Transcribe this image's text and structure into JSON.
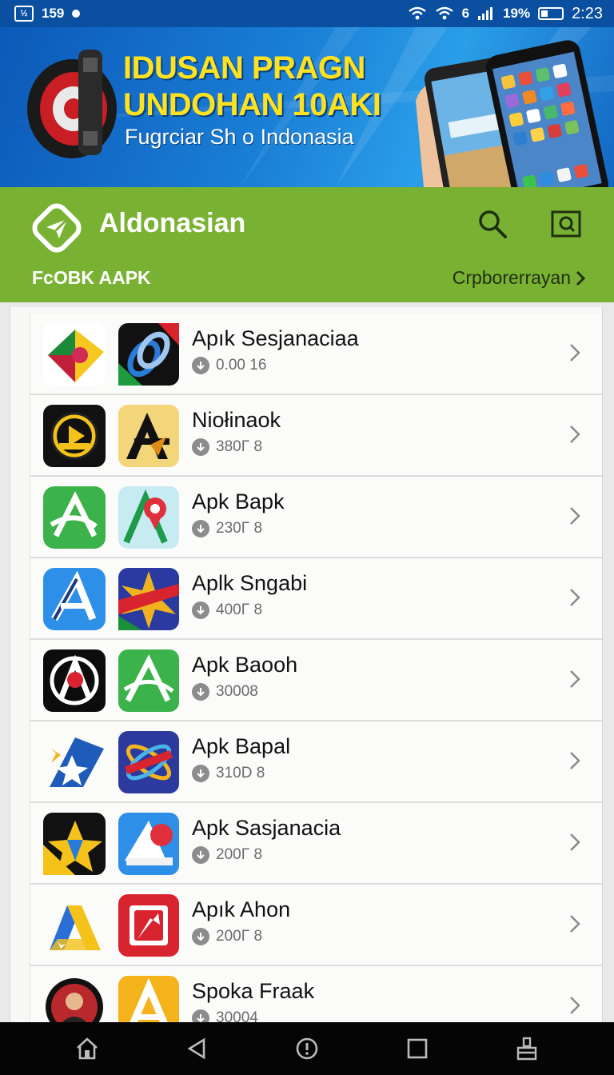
{
  "status_bar": {
    "notif_box": "½",
    "carrier": "159",
    "network": "6",
    "battery_percent": "19%",
    "time": "2:23"
  },
  "banner": {
    "title_line1": "IDUSAN PRAGN",
    "title_line2": "UNDOHAN 10AKI",
    "subtitle": "Fugrciar Sh o Indonasia"
  },
  "header": {
    "app_name": "Aldonasian",
    "section_label": "FcOBK AAPK",
    "right_link": "Crpborerrayan"
  },
  "apps": [
    {
      "name": "Apık Sesjanaciaa",
      "meta": "0.00 16",
      "icon1": "kite-app-icon",
      "icon2": "chain-link-app-icon"
    },
    {
      "name": "Niołinaok",
      "meta": "380Γ 8",
      "icon1": "play-badge-app-icon",
      "icon2": "letter-a-yellow-app-icon"
    },
    {
      "name": "Apk Bapk",
      "meta": "230Γ 8",
      "icon1": "green-a-app-icon",
      "icon2": "map-pin-a-app-icon"
    },
    {
      "name": "Aplk Sngabi",
      "meta": "400Γ 8",
      "icon1": "blue-a-app-icon",
      "icon2": "burst-sticker-app-icon"
    },
    {
      "name": "Apk Baooh",
      "meta": "30008",
      "icon1": "circle-a-dark-app-icon",
      "icon2": "green-a-outline-app-icon"
    },
    {
      "name": "Apk Bapal",
      "meta": "310D 8",
      "icon1": "blue-star-app-icon",
      "icon2": "atom-blue-app-icon"
    },
    {
      "name": "Apk Sasjanacia",
      "meta": "200Γ 8",
      "icon1": "yellow-star-app-icon",
      "icon2": "blue-paper-plane-app-icon"
    },
    {
      "name": "Apık Ahon",
      "meta": "200Γ 8",
      "icon1": "drive-triangle-app-icon",
      "icon2": "red-arrow-app-icon"
    },
    {
      "name": "Spoka Fraak",
      "meta": "30004",
      "icon1": "portrait-seal-app-icon",
      "icon2": "yellow-a-app-icon"
    }
  ],
  "colors": {
    "status_bar": "#0a4fa0",
    "header_green": "#79b233",
    "banner_yellow": "#ffe21f",
    "nav_bar": "#050505"
  }
}
